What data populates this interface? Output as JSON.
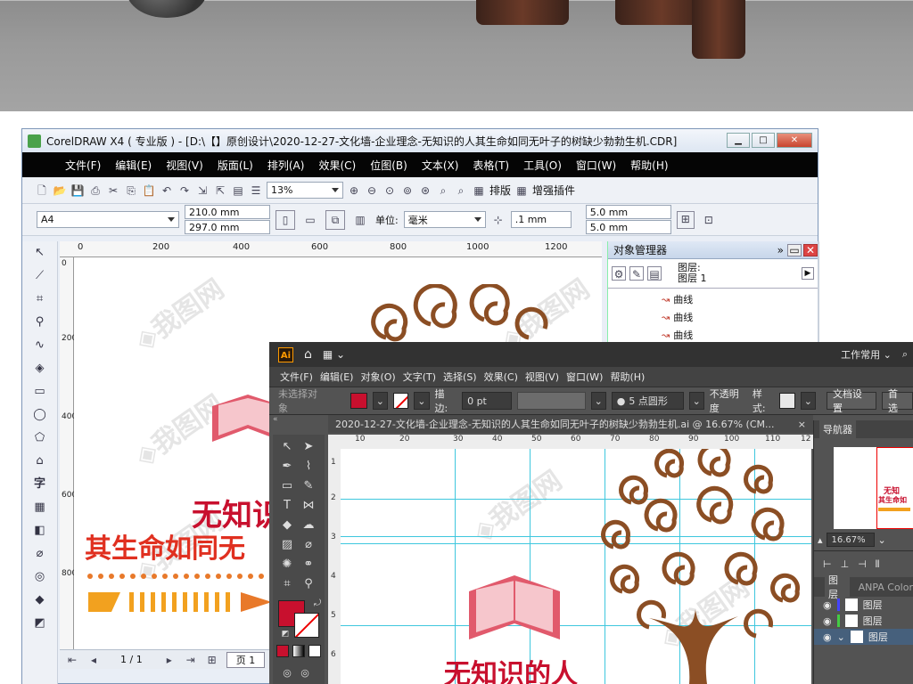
{
  "corel": {
    "title": "CorelDRAW X4 ( 专业版 ) - [D:\\【】原创设计\\2020-12-27-文化墙-企业理念-无知识的人其生命如同无叶子的树缺少勃勃生机.CDR]",
    "menu": [
      "文件(F)",
      "编辑(E)",
      "视图(V)",
      "版面(L)",
      "排列(A)",
      "效果(C)",
      "位图(B)",
      "文本(X)",
      "表格(T)",
      "工具(O)",
      "窗口(W)",
      "帮助(H)"
    ],
    "zoom": "13%",
    "paste_label": "排版",
    "plugin_label": "增强插件",
    "paper_size": "A4",
    "width": "210.0 mm",
    "height": "297.0 mm",
    "unit_label": "单位:",
    "unit": "毫米",
    "nudge": ".1 mm",
    "dup_x": "5.0 mm",
    "dup_y": "5.0 mm",
    "ruler_h": [
      "0",
      "200",
      "400",
      "600",
      "800",
      "1000",
      "1200"
    ],
    "ruler_v": [
      "0",
      "200",
      "400",
      "600",
      "800"
    ],
    "page_nav": "1 / 1",
    "page_tab": "页 1",
    "object_manager": {
      "title": "对象管理器",
      "layer1": "图层:",
      "layer2": "图层 1",
      "items": [
        "曲线",
        "曲线",
        "曲线"
      ]
    },
    "art": {
      "headline": "无知识",
      "subline": "其生命如同无"
    }
  },
  "ai": {
    "workspace": "工作常用",
    "menu": [
      "文件(F)",
      "编辑(E)",
      "对象(O)",
      "文字(T)",
      "选择(S)",
      "效果(C)",
      "视图(V)",
      "窗口(W)",
      "帮助(H)"
    ],
    "no_selection": "未选择对象",
    "stroke_label": "描边:",
    "stroke_value": "0 pt",
    "brush": "5 点圆形",
    "opacity_label": "不透明度",
    "style_label": "样式:",
    "doc_settings": "文档设置",
    "prefs": "首选",
    "doc_tab": "2020-12-27-文化墙-企业理念-无知识的人其生命如同无叶子的树缺少勃勃生机.ai @ 16.67% (CM...",
    "ruler": [
      "10",
      "20",
      "30",
      "40",
      "50",
      "60",
      "70",
      "80",
      "90",
      "100",
      "110",
      "12"
    ],
    "vruler": [
      "1",
      "2",
      "3",
      "4",
      "5",
      "6"
    ],
    "navigator": {
      "title": "导航器",
      "zoom": "16.67%",
      "thumb_line1": "无知",
      "thumb_line2": "其生命如"
    },
    "layers": {
      "tab1": "图层",
      "tab2": "ANPA Color",
      "rows": [
        "图层",
        "图层",
        "图层"
      ]
    },
    "art_headline": "无知识的人",
    "colors": {
      "fill": "#c8102e",
      "tree": "#8b4e24",
      "book": "#e15a6c",
      "guide": "#3ec7de"
    }
  }
}
